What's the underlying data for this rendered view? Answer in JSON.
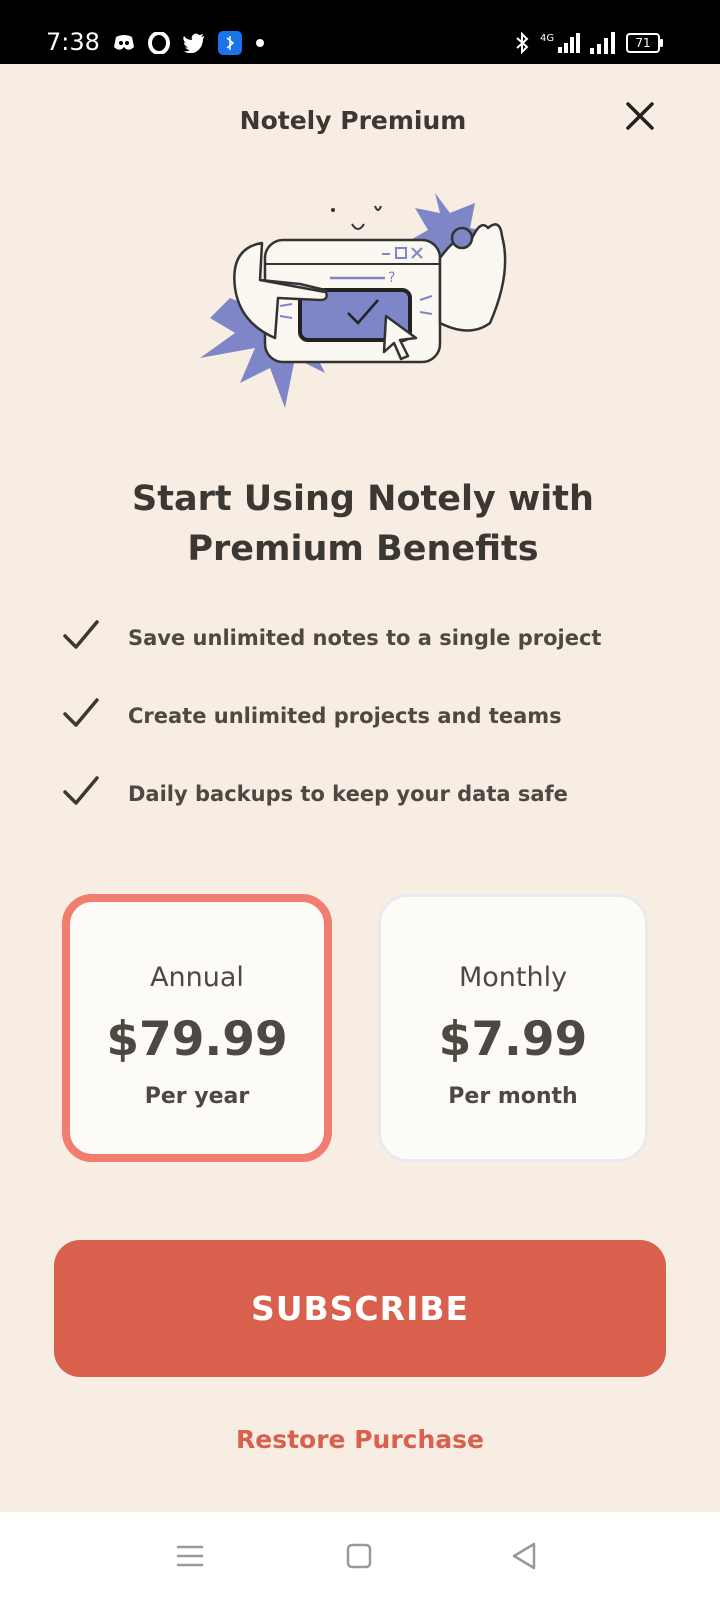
{
  "status_bar": {
    "time": "7:38",
    "battery": "71",
    "icons_left": [
      "discord-icon",
      "opera-icon",
      "twitter-icon",
      "app-icon",
      "dot-icon"
    ],
    "icons_right": [
      "bluetooth-icon",
      "signal-4g-icon",
      "signal-icon",
      "battery-icon"
    ]
  },
  "header": {
    "title": "Notely Premium",
    "close_icon": "close-icon"
  },
  "headline": {
    "line1": "Start Using Notely with",
    "line2": "Premium Benefits"
  },
  "benefits": [
    {
      "icon": "check-icon",
      "text": "Save unlimited notes to a single project"
    },
    {
      "icon": "check-icon",
      "text": "Create unlimited projects and teams"
    },
    {
      "icon": "check-icon",
      "text": "Daily backups to keep your data safe"
    }
  ],
  "plans": [
    {
      "name": "Annual",
      "price": "$79.99",
      "period": "Per year",
      "selected": true
    },
    {
      "name": "Monthly",
      "price": "$7.99",
      "period": "Per month",
      "selected": false
    }
  ],
  "subscribe_label": "SUBSCRIBE",
  "restore_label": "Restore Purchase",
  "colors": {
    "background": "#f7ede3",
    "accent": "#d9604c",
    "selected_border": "#f07d6d",
    "illustration_purple": "#7f86c8",
    "text": "#3b3733"
  },
  "nav_bar": {
    "icons": [
      "menu-icon",
      "home-icon",
      "back-icon"
    ]
  }
}
